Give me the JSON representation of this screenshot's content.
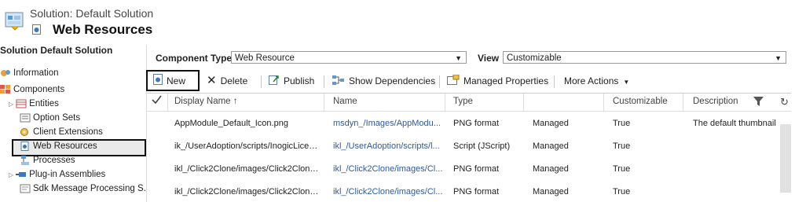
{
  "header": {
    "solution_label": "Solution: Default Solution",
    "page_title": "Web Resources"
  },
  "nav": {
    "section_title": "Solution Default Solution",
    "items": [
      {
        "label": "Information",
        "icon": "information-icon"
      },
      {
        "label": "Components",
        "icon": "components-icon"
      },
      {
        "label": "Entities",
        "icon": "entities-icon"
      },
      {
        "label": "Option Sets",
        "icon": "option-sets-icon"
      },
      {
        "label": "Client Extensions",
        "icon": "client-extensions-icon"
      },
      {
        "label": "Web Resources",
        "icon": "web-resources-icon",
        "selected": true
      },
      {
        "label": "Processes",
        "icon": "processes-icon"
      },
      {
        "label": "Plug-in Assemblies",
        "icon": "plugin-assemblies-icon"
      },
      {
        "label": "Sdk Message Processing S...",
        "icon": "sdk-message-icon"
      }
    ]
  },
  "filters": {
    "component_type_label": "Component Type",
    "component_type_value": "Web Resource",
    "view_label": "View",
    "view_value": "Customizable"
  },
  "toolbar": {
    "new": "New",
    "delete": "Delete",
    "publish": "Publish",
    "show_dependencies": "Show Dependencies",
    "managed_properties": "Managed Properties",
    "more_actions": "More Actions"
  },
  "grid": {
    "columns": [
      "Display Name",
      "Name",
      "Type",
      "",
      "Customizable",
      "Description"
    ],
    "sort_indicator": "↑",
    "rows": [
      {
        "display_name": "AppModule_Default_Icon.png",
        "name": "msdyn_/Images/AppModu...",
        "type": "PNG format",
        "state": "Managed",
        "customizable": "True",
        "description": "The default thumbnail"
      },
      {
        "display_name": "ik_/UserAdoption/scripts/InogicLicen...",
        "name": "ikl_/UserAdoption/scripts/l...",
        "type": "Script (JScript)",
        "state": "Managed",
        "customizable": "True",
        "description": ""
      },
      {
        "display_name": "ikl_/Click2Clone/images/Click2Clone...",
        "name": "ikl_/Click2Clone/images/Cl...",
        "type": "PNG format",
        "state": "Managed",
        "customizable": "True",
        "description": ""
      },
      {
        "display_name": "ikl_/Click2Clone/images/Click2Clone...",
        "name": "ikl_/Click2Clone/images/Cl...",
        "type": "PNG format",
        "state": "Managed",
        "customizable": "True",
        "description": ""
      }
    ]
  },
  "colors": {
    "link": "#2d5aa0",
    "highlight_border": "#111111"
  }
}
